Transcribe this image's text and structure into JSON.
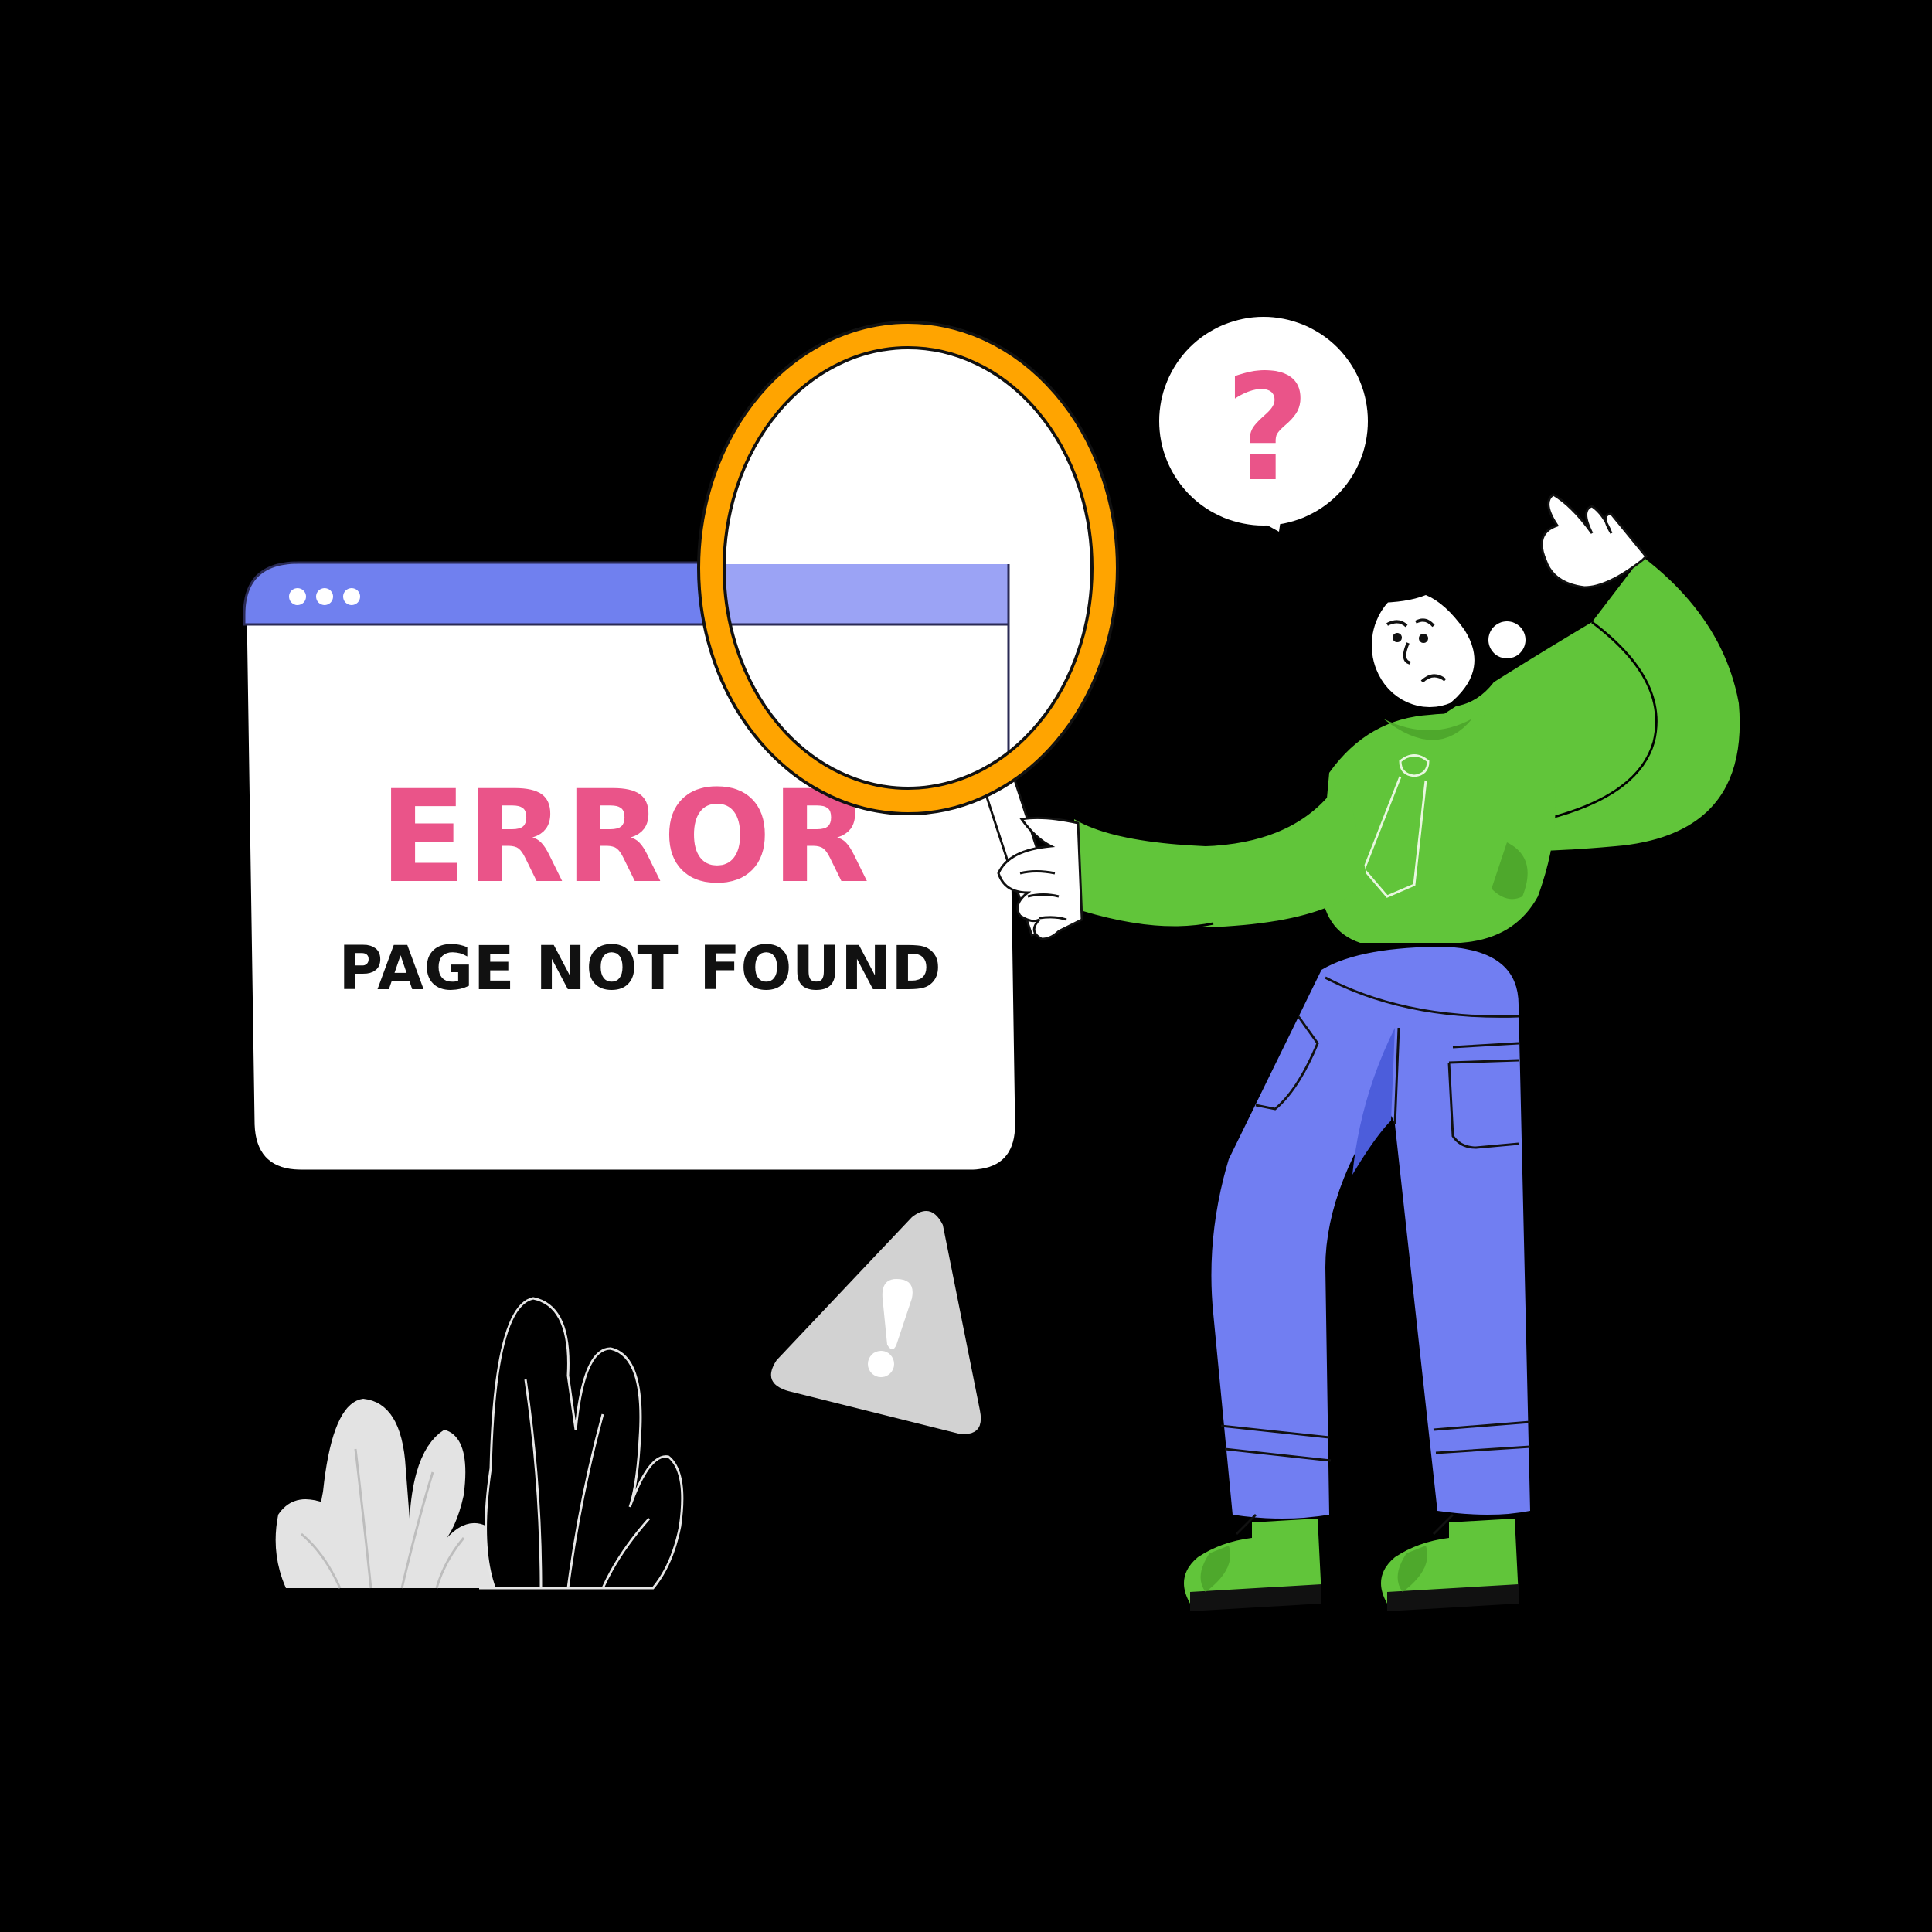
{
  "error_window": {
    "title": "ERROR",
    "subtitle": "PAGE NOT FOUND"
  },
  "speech_bubble": {
    "symbol": "?"
  },
  "warning_sign": {
    "icon": "exclamation-icon"
  },
  "colors": {
    "background": "#000000",
    "window_bar": "#7080ef",
    "window_bar_magnified": "#9ba3f5",
    "window_body": "#ffffff",
    "error_text": "#ea5489",
    "subtitle_text": "#111111",
    "magnifier_ring": "#ffa400",
    "question_mark": "#ea5489",
    "shirt": "#61c53a",
    "shirt_shade": "#4ea82c",
    "pants": "#717ef2",
    "pants_shade": "#4c5ddb",
    "shoes": "#61c53a",
    "warning_triangle": "#d2d2d2",
    "plant_light": "#e3e3e3"
  }
}
